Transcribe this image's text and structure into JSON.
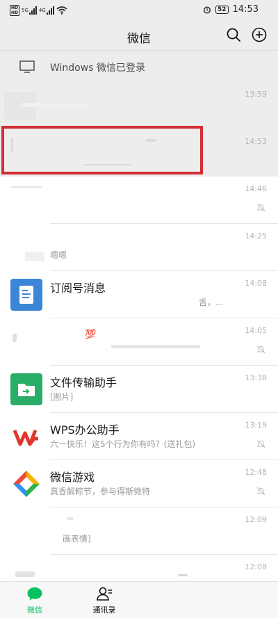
{
  "status_bar": {
    "time": "14:53",
    "battery": "52",
    "network_1": "5G",
    "network_2": "4G"
  },
  "nav": {
    "title": "微信"
  },
  "banner": {
    "text": "Windows 微信已登录"
  },
  "chats": [
    {
      "title": "",
      "preview": "",
      "time": "13:59",
      "muted": false,
      "pinned": true
    },
    {
      "title": "",
      "preview": "",
      "time": "14:53",
      "muted": false,
      "pinned": true
    },
    {
      "title": "",
      "preview": "",
      "time": "14:46",
      "muted": true,
      "pinned": false
    },
    {
      "title": "",
      "preview": "嗯嗯",
      "time": "14:25",
      "muted": false,
      "pinned": false
    },
    {
      "title": "订阅号消息",
      "preview": "舌，...",
      "time": "14:08",
      "muted": false,
      "pinned": false
    },
    {
      "title": "💯",
      "preview": "",
      "time": "14:05",
      "muted": true,
      "pinned": false
    },
    {
      "title": "文件传输助手",
      "preview": "[图片]",
      "time": "13:38",
      "muted": false,
      "pinned": false
    },
    {
      "title": "WPS办公助手",
      "preview": "六一快乐！这5个行为你有吗？(送礼包)",
      "time": "13:19",
      "muted": true,
      "pinned": false
    },
    {
      "title": "微信游戏",
      "preview": "真香解粽节，参与得斯微特",
      "time": "12:48",
      "muted": true,
      "pinned": false
    },
    {
      "title": "",
      "preview": "画表情]",
      "time": "12:09",
      "muted": false,
      "pinned": false
    },
    {
      "title": "",
      "preview": "",
      "time": "12:08",
      "muted": false,
      "pinned": false
    }
  ],
  "tabs": {
    "chats": "微信",
    "contacts": "通讯录"
  },
  "colors": {
    "accent_green": "#07c160",
    "highlight_red": "#d32f35"
  }
}
